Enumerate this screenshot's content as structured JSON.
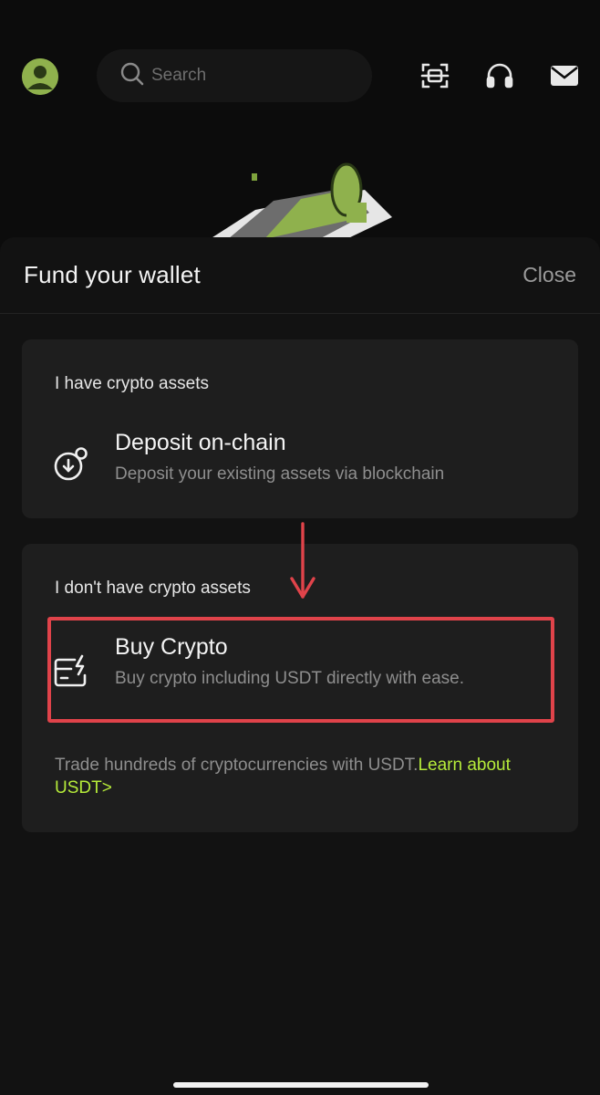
{
  "header": {
    "search_placeholder": "Search",
    "avatar_icon": "user-avatar-icon",
    "scan_icon": "scan-icon",
    "support_icon": "headset-icon",
    "mail_icon": "mail-icon"
  },
  "sheet": {
    "title": "Fund your wallet",
    "close_label": "Close",
    "sections": [
      {
        "heading": "I have crypto assets",
        "option": {
          "icon": "deposit-on-chain-icon",
          "title": "Deposit on-chain",
          "description": "Deposit your existing assets via blockchain"
        }
      },
      {
        "heading": "I don't have crypto assets",
        "option": {
          "icon": "buy-crypto-card-icon",
          "title": "Buy Crypto",
          "description": "Buy crypto including USDT directly with ease."
        },
        "note_text": "Trade hundreds of cryptocurrencies with USDT.",
        "note_link": "Learn about USDT>"
      }
    ]
  },
  "colors": {
    "background": "#0c0c0c",
    "sheet": "#121212",
    "card": "#1e1e1e",
    "accent": "#b6ec3a",
    "highlight": "#e0434a"
  }
}
